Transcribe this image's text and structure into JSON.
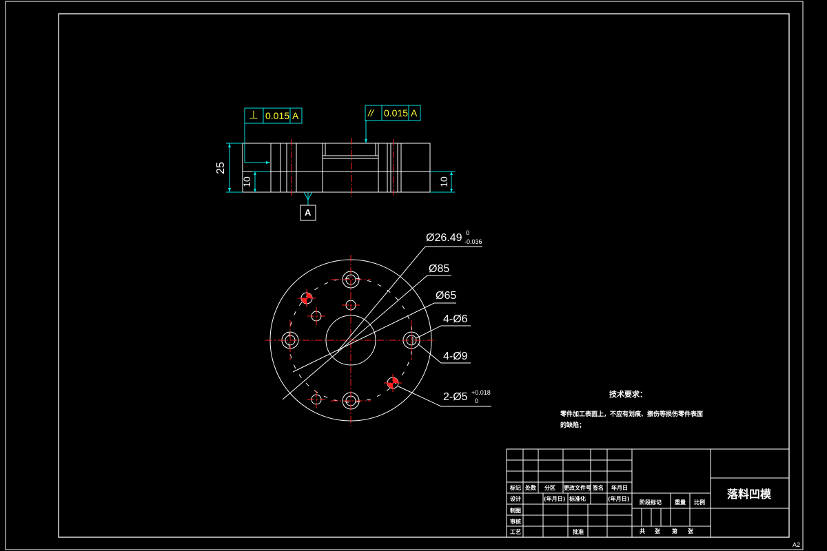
{
  "drawing": {
    "title": "落料凹模",
    "sheet_size": "A2",
    "colors": {
      "background": "#000000",
      "outline": "#ffffff",
      "centerline": "#ff2020",
      "dimension": "#00e5e5",
      "tolerance_text": "#ffff3c"
    }
  },
  "tolerance_frames": {
    "left": {
      "symbol": "⊥",
      "symbol_name": "perpendicularity",
      "value": "0.015",
      "datum": "A"
    },
    "right": {
      "symbol": "//",
      "symbol_name": "parallelism",
      "value": "0.015",
      "datum": "A"
    }
  },
  "datum_label": "A",
  "side_view_dims": {
    "height": "25",
    "left_step": "10",
    "right_step": "10"
  },
  "plan_view_dims": {
    "d1_main": "Ø26.49",
    "d1_upper": "0",
    "d1_lower": "-0.036",
    "d2": "Ø85",
    "d3": "Ø65",
    "d4": "4-Ø6",
    "d5": "4-Ø9",
    "d6_main": "2-Ø5",
    "d6_upper": "+0.018",
    "d6_lower": "0"
  },
  "tech_requirements": {
    "heading": "技术要求：",
    "line1": "零件加工表面上，不应有划痕、擦伤等损伤零件表面",
    "line2": "的缺陷；"
  },
  "title_block": {
    "row_headers": [
      "标记",
      "处数",
      "分区",
      "更改文件号",
      "签名",
      "年月日"
    ],
    "design": "设计",
    "design_date1": "(年月日)",
    "standardization": "标准化",
    "design_date2": "(年月日)",
    "drafting": "制图",
    "review": "审核",
    "process": "工艺",
    "approve": "批准",
    "stage_mark": "阶段标记",
    "weight": "重量",
    "scale": "比例",
    "total": "共",
    "sheets": "张",
    "sheet_no": "第",
    "sheet_unit": "张"
  }
}
